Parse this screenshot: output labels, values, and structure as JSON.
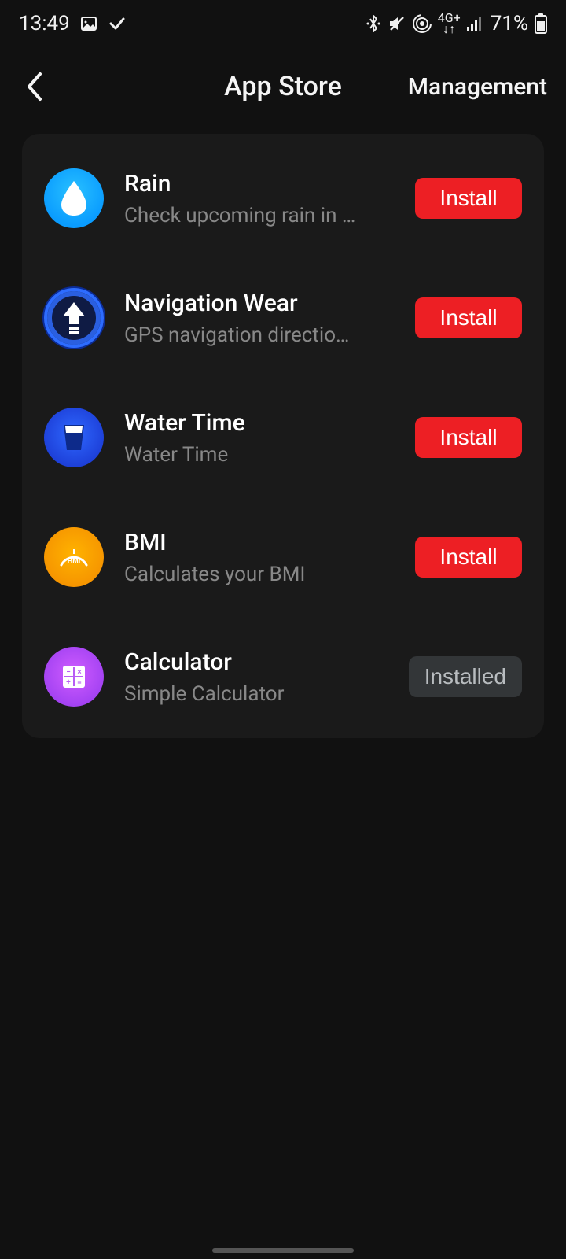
{
  "statusbar": {
    "time": "13:49",
    "battery_pct": "71%",
    "net_label": "4G+"
  },
  "header": {
    "title": "App Store",
    "management": "Management"
  },
  "buttons": {
    "install": "Install",
    "installed": "Installed"
  },
  "apps": [
    {
      "name": "Rain",
      "subtitle": "Check upcoming rain in a …",
      "state": "install"
    },
    {
      "name": "Navigation Wear",
      "subtitle": "GPS navigation directions …",
      "state": "install"
    },
    {
      "name": "Water Time",
      "subtitle": "Water Time",
      "state": "install"
    },
    {
      "name": "BMI",
      "subtitle": "Calculates your BMI",
      "state": "install"
    },
    {
      "name": "Calculator",
      "subtitle": "Simple Calculator",
      "state": "installed"
    }
  ]
}
